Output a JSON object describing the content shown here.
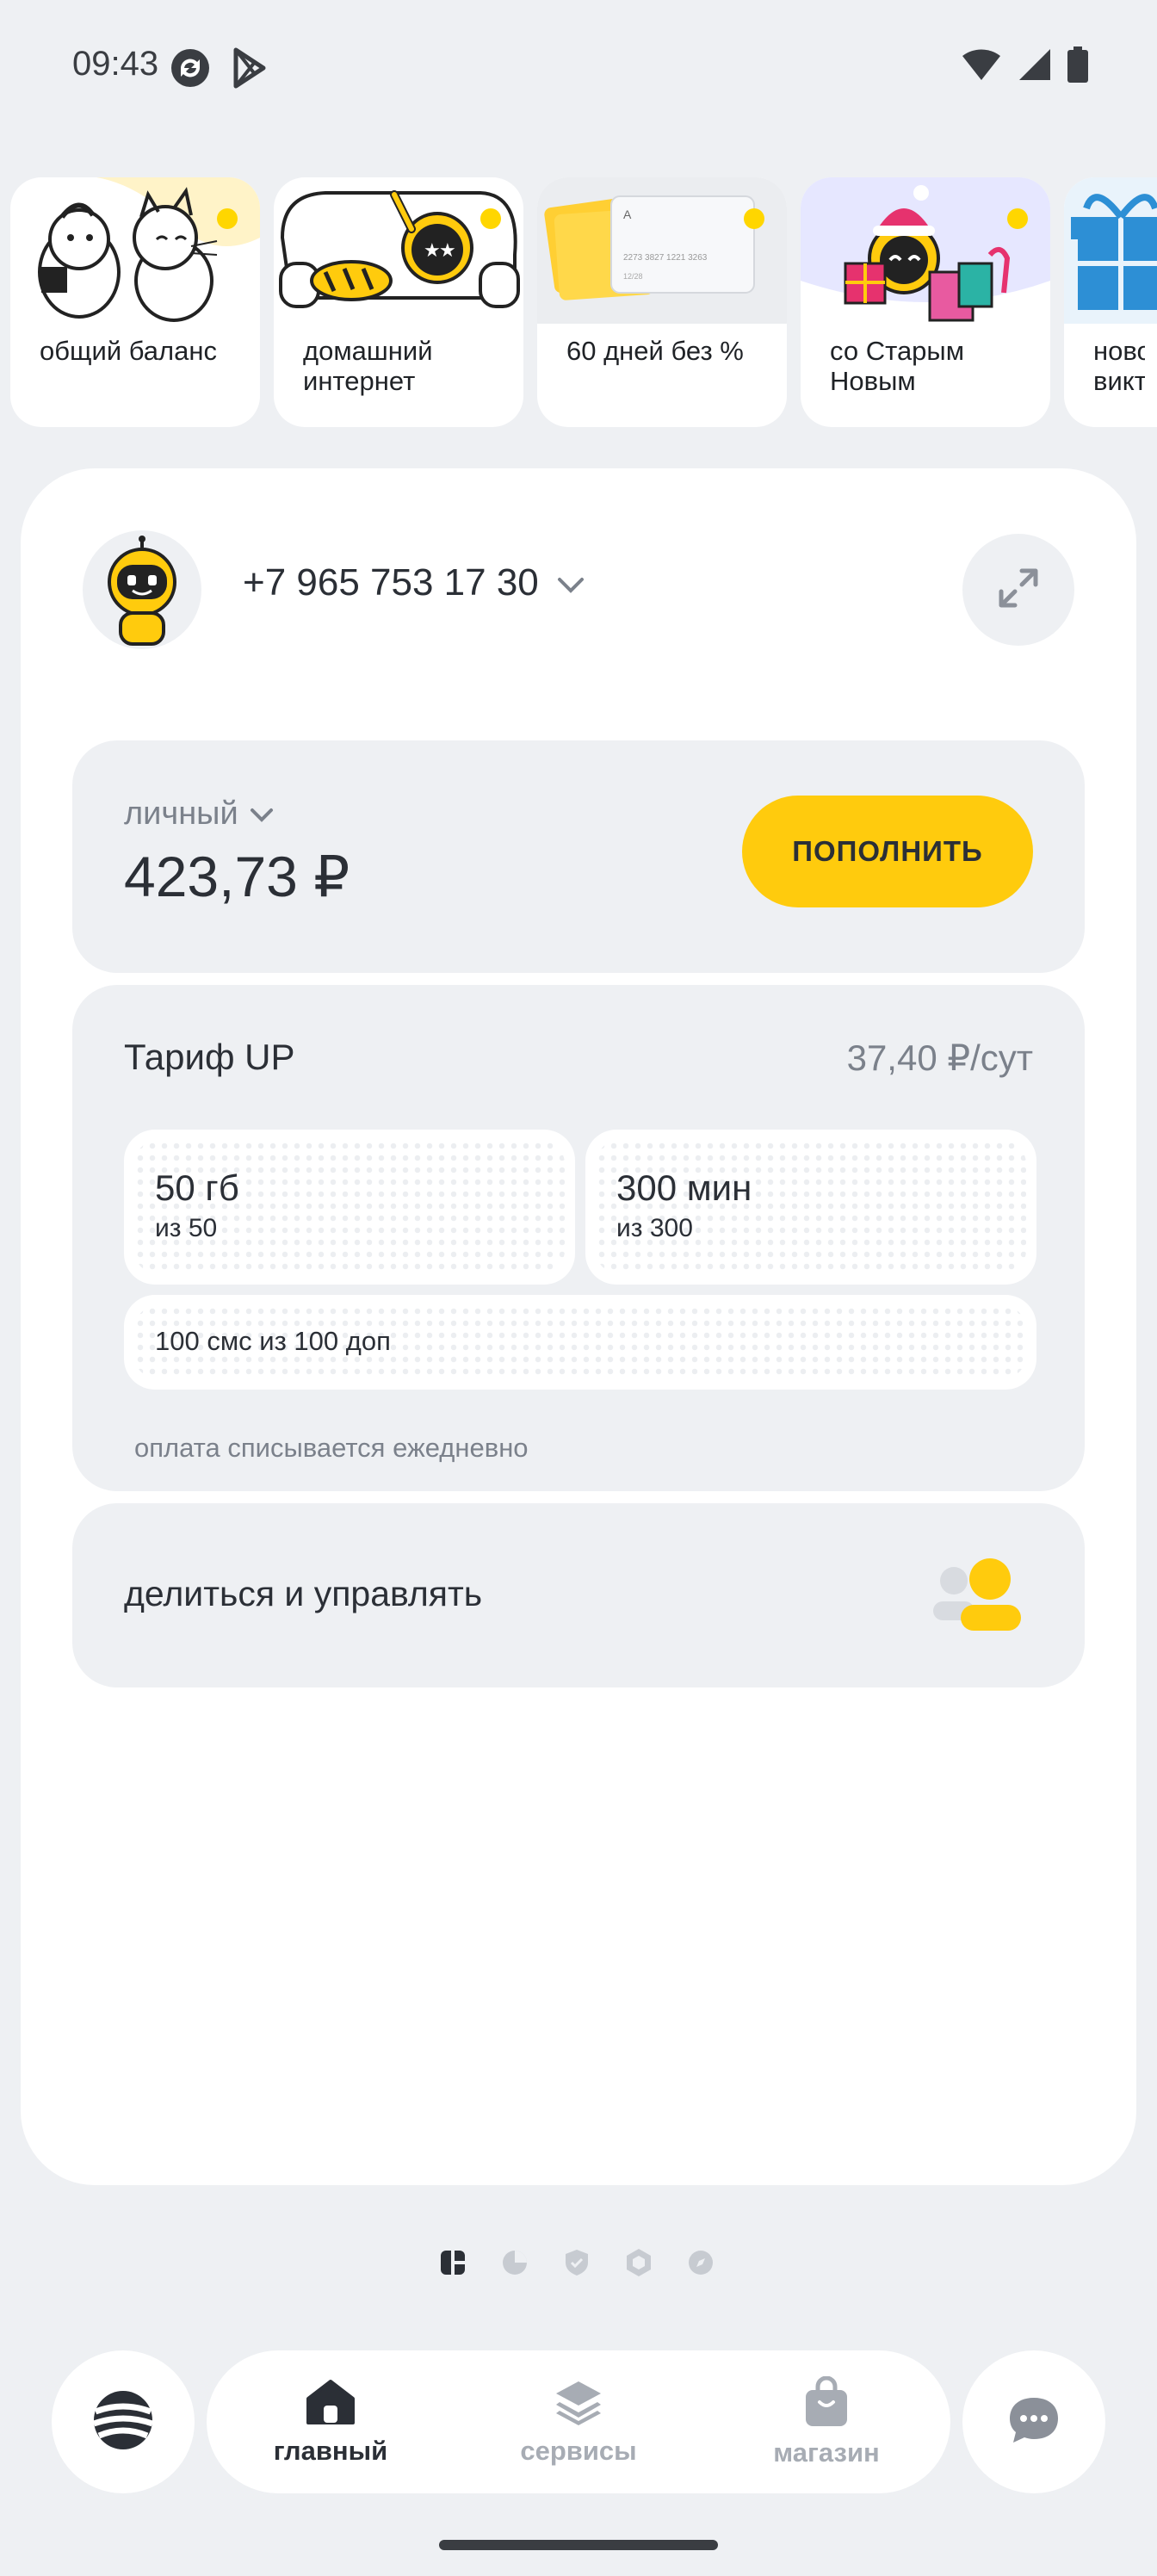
{
  "status_bar": {
    "time": "09:43",
    "icons_left": [
      "sync-icon",
      "play-store-icon"
    ],
    "icons_right": [
      "wifi-icon",
      "signal-icon",
      "battery-icon"
    ]
  },
  "stories": [
    {
      "label": "общий баланс",
      "art": "cats-illustration"
    },
    {
      "label": "домашний интернет",
      "art": "robot-on-couch-illustration"
    },
    {
      "label": "60 дней без %",
      "art": "credit-cards-illustration"
    },
    {
      "label": "со Старым Новым",
      "art": "robot-with-gifts-illustration"
    },
    {
      "label": "ново викто",
      "art": "gift-box-illustration"
    }
  ],
  "account": {
    "phone": "+7 965 753 17 30",
    "avatar": "robot-avatar"
  },
  "balance": {
    "kind": "личный",
    "amount": "423,73 ₽",
    "topup_label": "пополнить"
  },
  "tariff": {
    "name": "Тариф UP",
    "price": "37,40 ₽/сут",
    "data_main": "50 гб",
    "data_sub": "из 50",
    "minutes_main": "300 мин",
    "minutes_sub": "из 300",
    "sms_line": "100 смс из 100 доп",
    "note": "оплата списывается ежедневно"
  },
  "share": {
    "label": "делиться и управлять"
  },
  "pager": {
    "icons": [
      "dashboard-icon",
      "pie-chart-icon",
      "shield-icon",
      "hexagon-icon",
      "compass-icon"
    ],
    "active_index": 0
  },
  "nav": {
    "items": [
      {
        "label": "главный",
        "icon": "home-icon",
        "active": true
      },
      {
        "label": "сервисы",
        "icon": "layers-icon",
        "active": false
      },
      {
        "label": "магазин",
        "icon": "shopping-bag-icon",
        "active": false
      }
    ]
  },
  "colors": {
    "accent": "#ffcb0d",
    "background": "#eef0f3",
    "card": "#ffffff",
    "text": "#2b2f36",
    "muted": "#7b818b"
  }
}
